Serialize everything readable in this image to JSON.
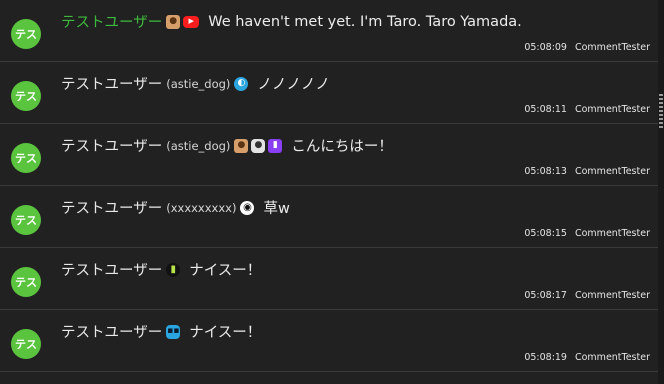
{
  "comments": [
    {
      "avatar": "テス",
      "user": "テストユーザー",
      "user_color": "#3dba3d",
      "handle": "",
      "icons": [
        "dog-icon",
        "youtube-icon"
      ],
      "message": "We haven't met yet. I'm Taro. Taro Yamada.",
      "time": "05:08:09",
      "source": "CommentTester"
    },
    {
      "avatar": "テス",
      "user": "テストユーザー",
      "user_color": "#e8e8e8",
      "handle": "(astie_dog)",
      "icons": [
        "globe-icon"
      ],
      "message": "ノノノノノ",
      "time": "05:08:11",
      "source": "CommentTester"
    },
    {
      "avatar": "テス",
      "user": "テストユーザー",
      "user_color": "#e8e8e8",
      "handle": "(astie_dog)",
      "icons": [
        "dog-icon",
        "cat-icon",
        "twitch-icon"
      ],
      "message": "こんにちはー！",
      "time": "05:08:13",
      "source": "CommentTester"
    },
    {
      "avatar": "テス",
      "user": "テストユーザー",
      "user_color": "#e8e8e8",
      "handle": "(xxxxxxxxx)",
      "icons": [
        "swirl-icon"
      ],
      "message": "草w",
      "time": "05:08:15",
      "source": "CommentTester"
    },
    {
      "avatar": "テス",
      "user": "テストユーザー",
      "user_color": "#e8e8e8",
      "handle": "",
      "icons": [
        "bottle-icon"
      ],
      "message": "ナイスー！",
      "time": "05:08:17",
      "source": "CommentTester"
    },
    {
      "avatar": "テス",
      "user": "テストユーザー",
      "user_color": "#e8e8e8",
      "handle": "",
      "icons": [
        "niconico-icon"
      ],
      "message": "ナイスー！",
      "time": "05:08:19",
      "source": "CommentTester"
    }
  ]
}
